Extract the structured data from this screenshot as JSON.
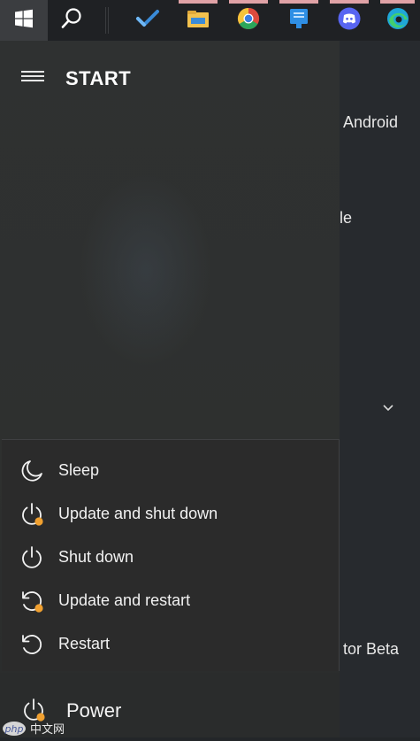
{
  "taskbar": {
    "start_icon": "windows-logo-icon",
    "search_icon": "search-icon",
    "apps": [
      {
        "name": "to-do-icon",
        "color": "#3a8bd8"
      },
      {
        "name": "file-explorer-icon",
        "color": "#f2c14e"
      },
      {
        "name": "chrome-icon",
        "color": "#dd4b3e"
      },
      {
        "name": "app-icon",
        "color": "#2f8fe5"
      },
      {
        "name": "discord-icon",
        "color": "#5865f2"
      },
      {
        "name": "edge-icon",
        "color": "#1fa7d8"
      }
    ]
  },
  "start": {
    "menu_icon": "hamburger-icon",
    "title": "START"
  },
  "background": {
    "text1": "Android",
    "text2": "le",
    "text3": "tor Beta",
    "chevron_icon": "chevron-down-icon"
  },
  "power_menu": {
    "items": [
      {
        "label": "Sleep",
        "icon": "moon-icon"
      },
      {
        "label": "Update and shut down",
        "icon": "power-update-icon"
      },
      {
        "label": "Shut down",
        "icon": "power-icon"
      },
      {
        "label": "Update and restart",
        "icon": "restart-update-icon"
      },
      {
        "label": "Restart",
        "icon": "restart-icon"
      }
    ],
    "update_badge_color": "#f0a030"
  },
  "power_button": {
    "label": "Power",
    "icon": "power-update-icon"
  },
  "watermark": {
    "text": "php 中文网"
  }
}
